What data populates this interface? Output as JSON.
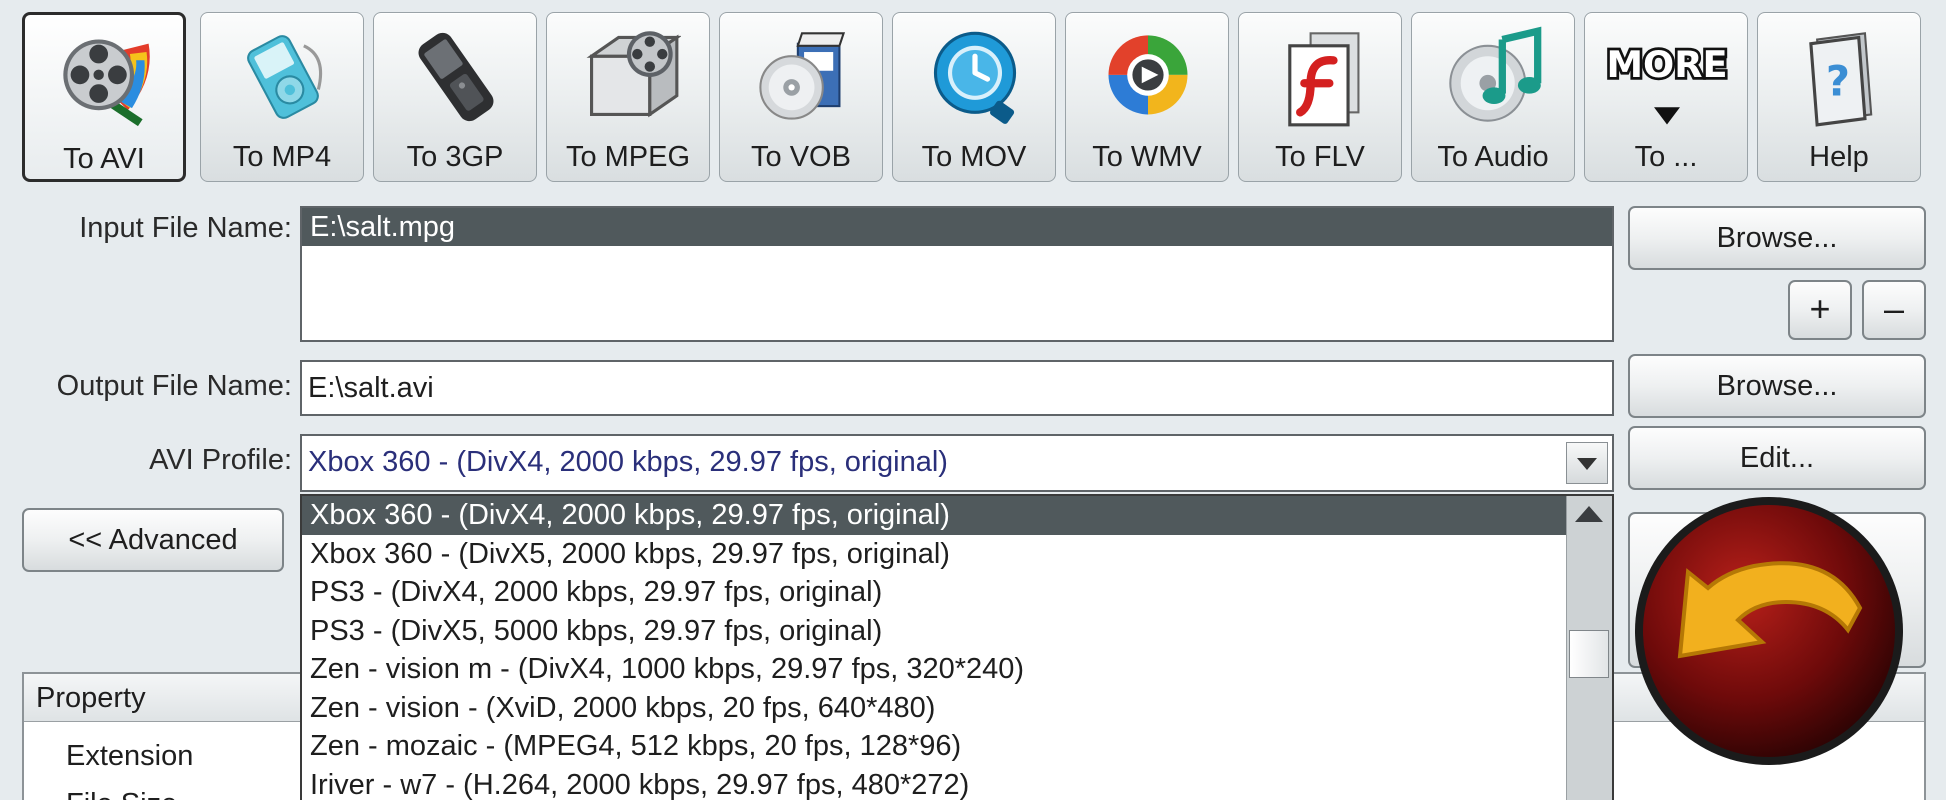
{
  "toolbar": {
    "buttons": [
      {
        "label": "To AVI",
        "icon": "film-reel-icon",
        "active": true
      },
      {
        "label": "To MP4",
        "icon": "mp4-player-icon",
        "active": false
      },
      {
        "label": "To 3GP",
        "icon": "mobile-phone-icon",
        "active": false
      },
      {
        "label": "To MPEG",
        "icon": "film-camera-icon",
        "active": false
      },
      {
        "label": "To VOB",
        "icon": "dvd-disc-icon",
        "active": false
      },
      {
        "label": "To MOV",
        "icon": "quicktime-icon",
        "active": false
      },
      {
        "label": "To WMV",
        "icon": "windows-media-icon",
        "active": false
      },
      {
        "label": "To FLV",
        "icon": "flash-icon",
        "active": false
      },
      {
        "label": "To Audio",
        "icon": "music-cd-icon",
        "active": false
      },
      {
        "label": "To ...",
        "icon": "more-icon",
        "more_text": "MORE",
        "active": false
      },
      {
        "label": "Help",
        "icon": "help-book-icon",
        "active": false
      }
    ]
  },
  "input": {
    "label": "Input File Name:",
    "files": [
      "E:\\salt.mpg"
    ],
    "browse_label": "Browse...",
    "add_label": "+",
    "remove_label": "–"
  },
  "output": {
    "label": "Output File Name:",
    "value": "E:\\salt.avi",
    "browse_label": "Browse..."
  },
  "profile": {
    "label": "AVI Profile:",
    "selected": "Xbox 360 - (DivX4, 2000 kbps, 29.97 fps, original)",
    "edit_label": "Edit...",
    "options": [
      "Xbox 360 - (DivX4, 2000 kbps, 29.97 fps, original)",
      "Xbox 360 - (DivX5, 2000 kbps, 29.97 fps, original)",
      "PS3 - (DivX4, 2000 kbps, 29.97 fps, original)",
      "PS3 - (DivX5, 5000 kbps, 29.97 fps, original)",
      "Zen - vision m - (DivX4, 1000 kbps, 29.97 fps, 320*240)",
      "Zen - vision - (XviD, 2000  kbps, 20 fps, 640*480)",
      "Zen - mozaic - (MPEG4, 512 kbps, 20 fps, 128*96)",
      "Iriver - w7 - (H.264, 2000 kbps, 29.97 fps, 480*272)"
    ]
  },
  "advanced": {
    "label": "<< Advanced"
  },
  "properties": {
    "header": "Property",
    "rows": [
      "Extension",
      "File Size"
    ]
  },
  "colors": {
    "selection": "#50595c",
    "convert_ball": "#7a0c0c",
    "convert_arrow": "#f2b01e"
  }
}
